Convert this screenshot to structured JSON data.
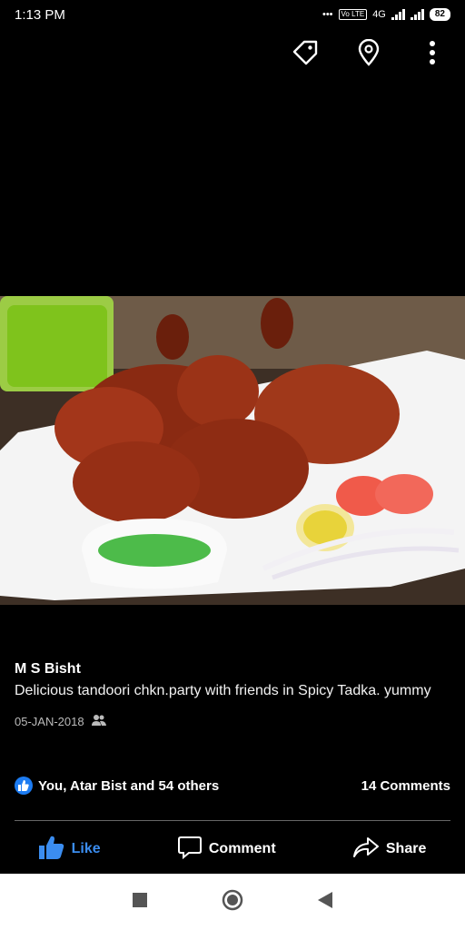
{
  "status_bar": {
    "time": "1:13 PM",
    "network": "4G",
    "volte": "Vo LTE",
    "battery": "82"
  },
  "post": {
    "author": "M S Bisht",
    "caption": "Delicious tandoori chkn.party with friends in Spicy Tadka. yummy",
    "date": "05-JAN-2018",
    "reactions_summary": "You, Atar Bist and 54 others",
    "comments_count": "14 Comments"
  },
  "actions": {
    "like": "Like",
    "comment": "Comment",
    "share": "Share"
  },
  "colors": {
    "like_blue": "#1d7cf2",
    "background": "#000000"
  }
}
